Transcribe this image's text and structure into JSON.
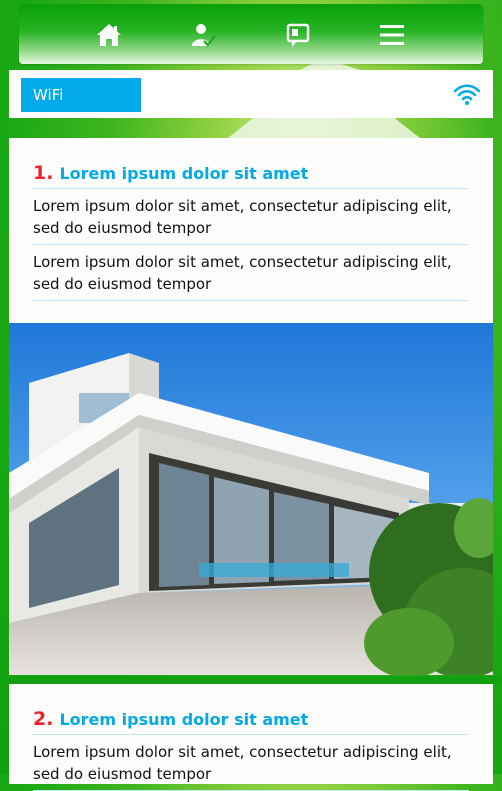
{
  "nav": {
    "icons": [
      "home-icon",
      "user-check-icon",
      "chat-icon",
      "menu-icon"
    ]
  },
  "wifi": {
    "tab_label": "WiFi",
    "accent": "#03a9e8"
  },
  "sections": [
    {
      "number": "1.",
      "title": "Lorem ipsum dolor sit amet",
      "paragraphs": [
        "Lorem ipsum dolor sit amet, consectetur adipiscing elit, sed do eiusmod tempor",
        "Lorem ipsum dolor sit amet, consectetur adipiscing elit, sed do eiusmod tempor"
      ]
    },
    {
      "number": "2.",
      "title": "Lorem ipsum dolor sit amet",
      "paragraphs": [
        "Lorem ipsum dolor sit amet, consectetur adipiscing elit, sed do eiusmod tempor"
      ]
    }
  ],
  "colors": {
    "number": "#e8242a",
    "title": "#03a9e8",
    "background_green": "#1aa814"
  }
}
